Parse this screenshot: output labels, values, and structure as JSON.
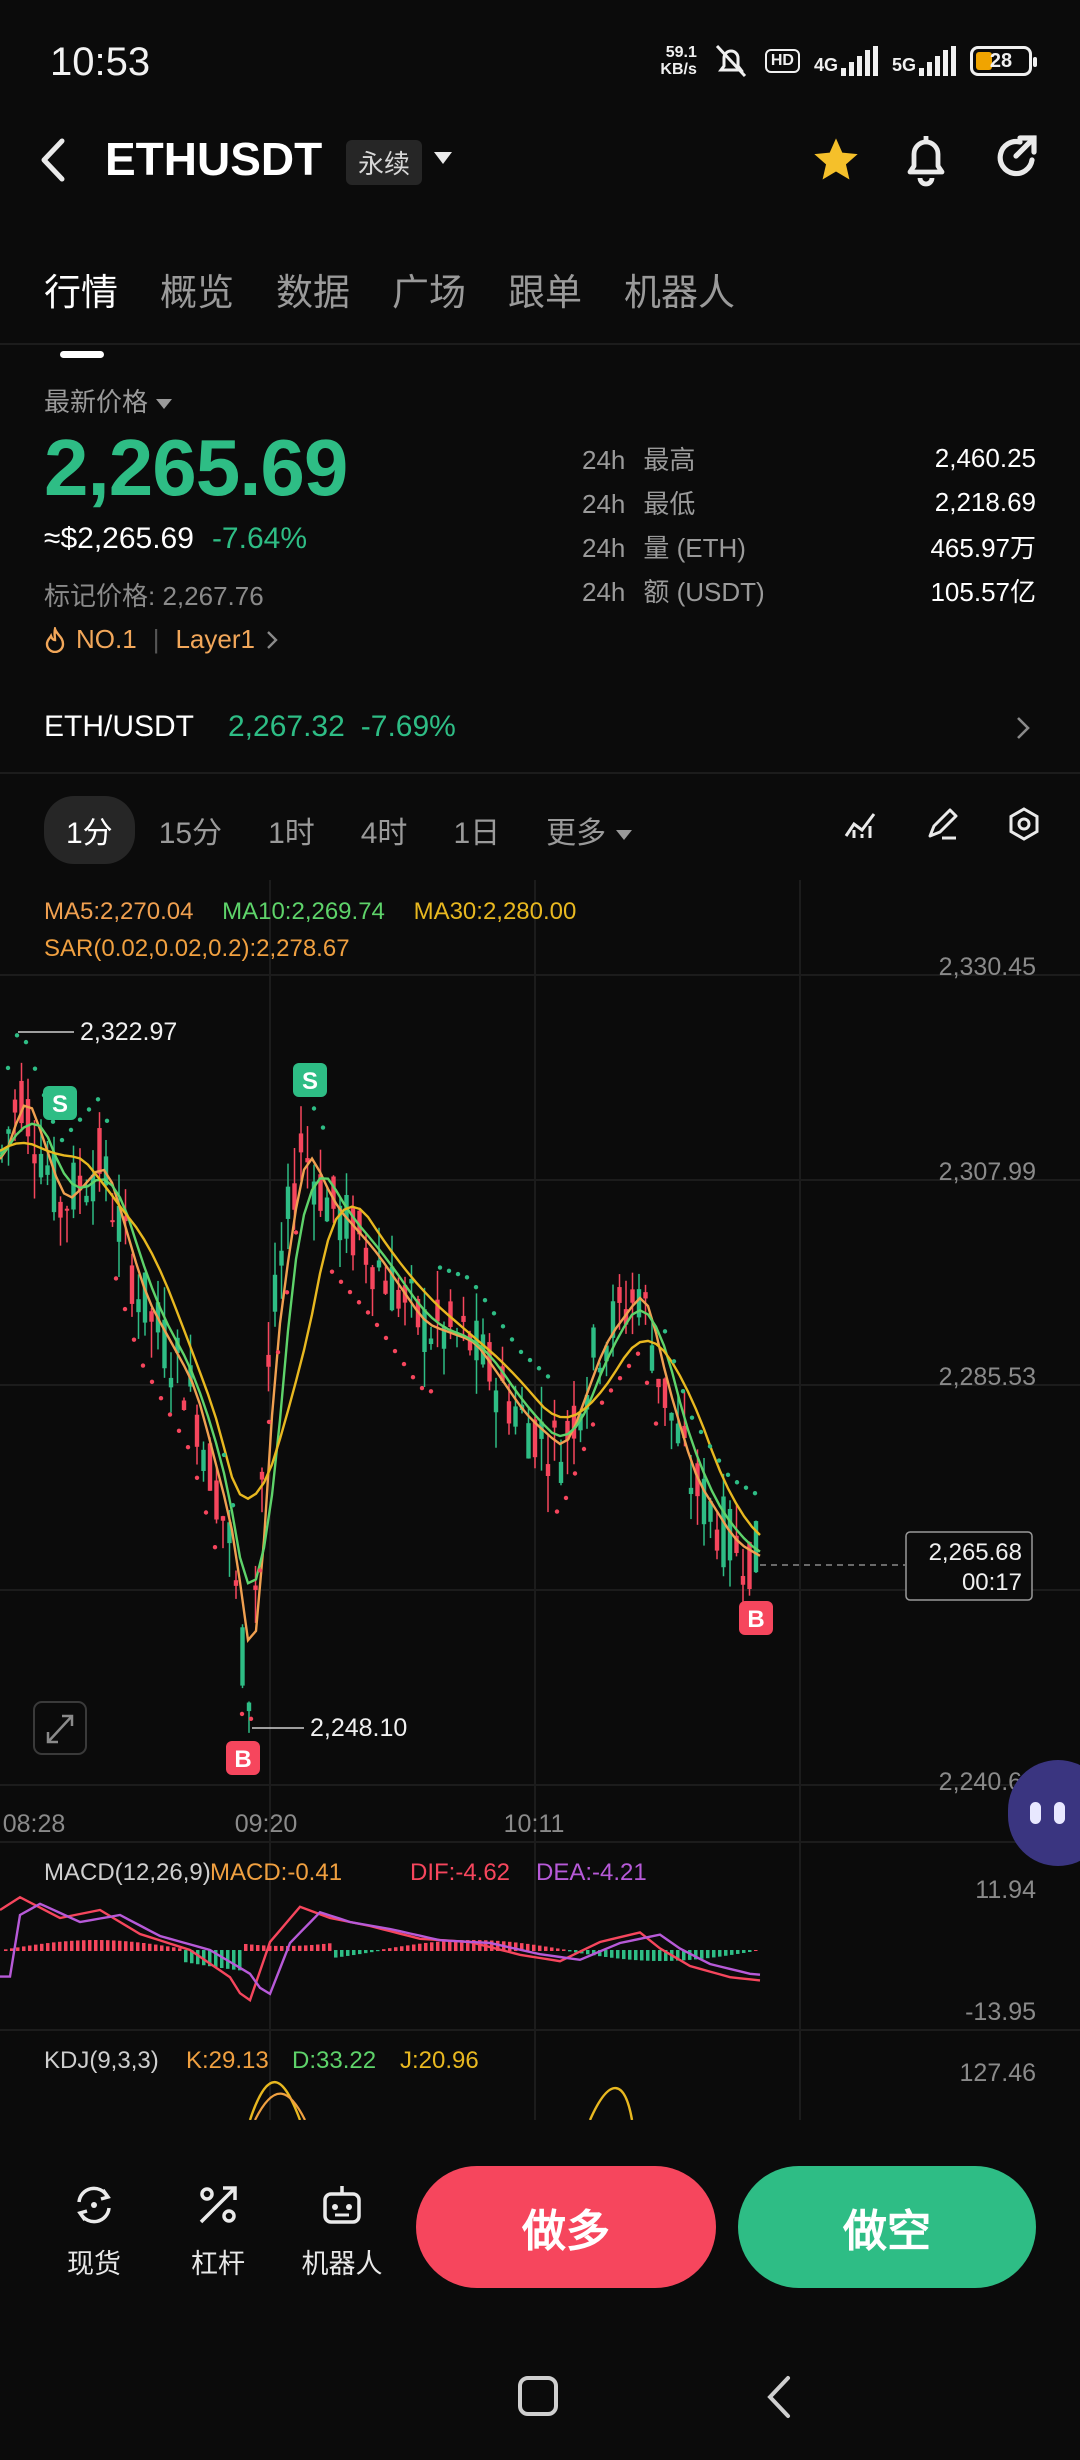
{
  "status_bar": {
    "time": "10:53",
    "net_speed_top": "59.1",
    "net_speed_bottom": "KB/s",
    "hd_label": "HD",
    "sim1": "4G",
    "sim2": "5G",
    "battery": "28"
  },
  "header": {
    "symbol": "ETHUSDT",
    "contract_type": "永续"
  },
  "tabs": [
    "行情",
    "概览",
    "数据",
    "广场",
    "跟单",
    "机器人"
  ],
  "price": {
    "latest_label": "最新价格",
    "last": "2,265.69",
    "usd": "≈$2,265.69",
    "change": "-7.64%",
    "mark_label": "标记价格:",
    "mark": "2,267.76",
    "rank": "NO.1",
    "tag": "Layer1"
  },
  "stats": [
    {
      "period": "24h",
      "label": "最高",
      "value": "2,460.25"
    },
    {
      "period": "24h",
      "label": "最低",
      "value": "2,218.69"
    },
    {
      "period": "24h",
      "label": "量 (ETH)",
      "value": "465.97万"
    },
    {
      "period": "24h",
      "label": "额 (USDT)",
      "value": "105.57亿"
    }
  ],
  "spot": {
    "pair": "ETH/USDT",
    "price": "2,267.32",
    "change": "-7.69%"
  },
  "intervals": {
    "items": [
      "1分",
      "15分",
      "1时",
      "4时",
      "1日"
    ],
    "more": "更多"
  },
  "chart": {
    "ma5": "MA5:2,270.04",
    "ma10": "MA10:2,269.74",
    "ma30": "MA30:2,280.00",
    "sar": "SAR(0.02,0.02,0.2):2,278.67",
    "y_ticks": [
      "2,330.45",
      "2,307.99",
      "2,285.53",
      "2,240.61"
    ],
    "x_ticks": [
      "08:28",
      "09:20",
      "10:11"
    ],
    "high_label": "2,322.97",
    "low_label": "2,248.10",
    "current_price": "2,265.68",
    "countdown": "00:17",
    "signal_sell": "S",
    "signal_buy": "B",
    "colors": {
      "ma5": "#f0a050",
      "ma10": "#5ed36a",
      "ma30": "#e8b820",
      "sar": "#f0a040",
      "up": "#2ebd85",
      "down": "#f6465d"
    }
  },
  "macd": {
    "label": "MACD(12,26,9)",
    "macd": "MACD:-0.41",
    "dif": "DIF:-4.62",
    "dea": "DEA:-4.21",
    "top": "11.94",
    "bottom": "-13.95"
  },
  "kdj": {
    "label": "KDJ(9,3,3)",
    "k": "K:29.13",
    "d": "D:33.22",
    "j": "J:20.96",
    "top": "127.46"
  },
  "actions": {
    "spot": "现货",
    "leverage": "杠杆",
    "bot": "机器人",
    "long": "做多",
    "short": "做空"
  }
}
